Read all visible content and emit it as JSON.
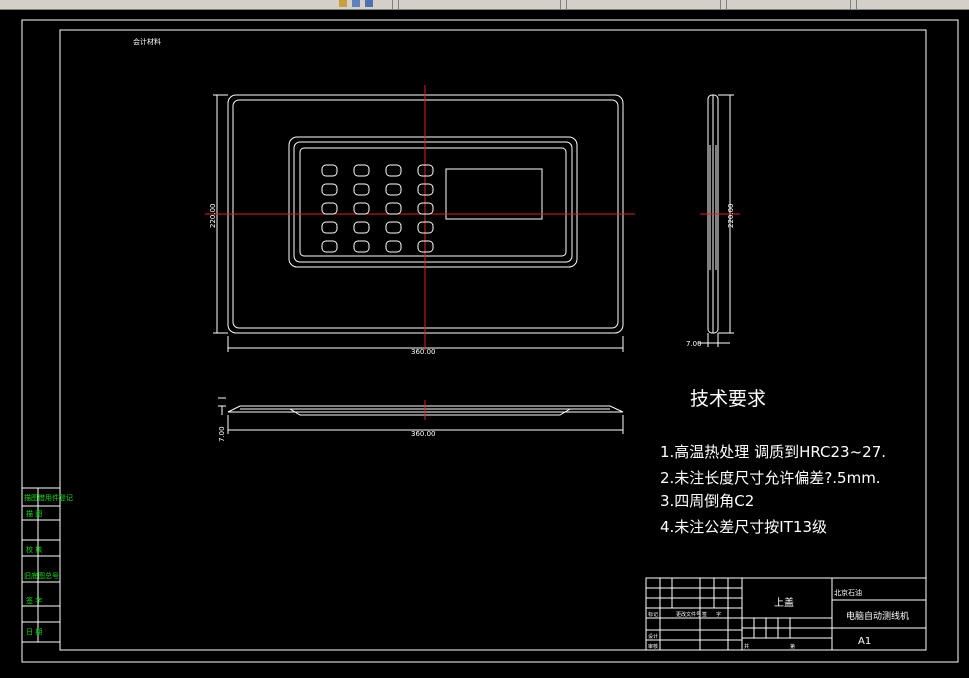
{
  "toolbar": {
    "tabs": [
      "",
      "",
      "",
      "",
      "",
      ""
    ],
    "icons": [
      "pan-icon",
      "zoom-icon",
      "folder-icon"
    ]
  },
  "drawing": {
    "top_left_title": "会计材料",
    "dimensions": {
      "front_width": "360.00",
      "front_height": "220.00",
      "side_height": "220.00",
      "side_thickness": "7.00",
      "bottom_width": "360.00",
      "bottom_thickness": "7.00"
    },
    "keypad": {
      "rows": 5,
      "cols": 4
    },
    "requirements": {
      "title": "技术要求",
      "items": [
        "1.高温热处理  调质到HRC23~27.",
        "2.未注长度尺寸允许偏差?.5mm.",
        "3.四周倒角C2",
        "4.未注公差尺寸按IT13级"
      ]
    },
    "side_labels": [
      "描图借用件登记",
      "描  图",
      "校  核",
      "旧底图总号",
      "签  字",
      "日  期"
    ],
    "title_block": {
      "part_name": "上盖",
      "company": "北京石油",
      "product": "电脑自动测线机",
      "sheet_size": "A1",
      "small_labels": [
        "标记",
        "处数",
        "更改文件号",
        "签",
        "字",
        "日期",
        "设计",
        "审核",
        "工艺",
        "阶段标记",
        "重量",
        "比例",
        "共",
        "张",
        "第",
        "张"
      ]
    },
    "colors": {
      "background": "#000000",
      "lines": "#ffffff",
      "centerline": "#ff0000",
      "side_text": "#00ff00",
      "toolbar": "#d4d0c8"
    }
  }
}
